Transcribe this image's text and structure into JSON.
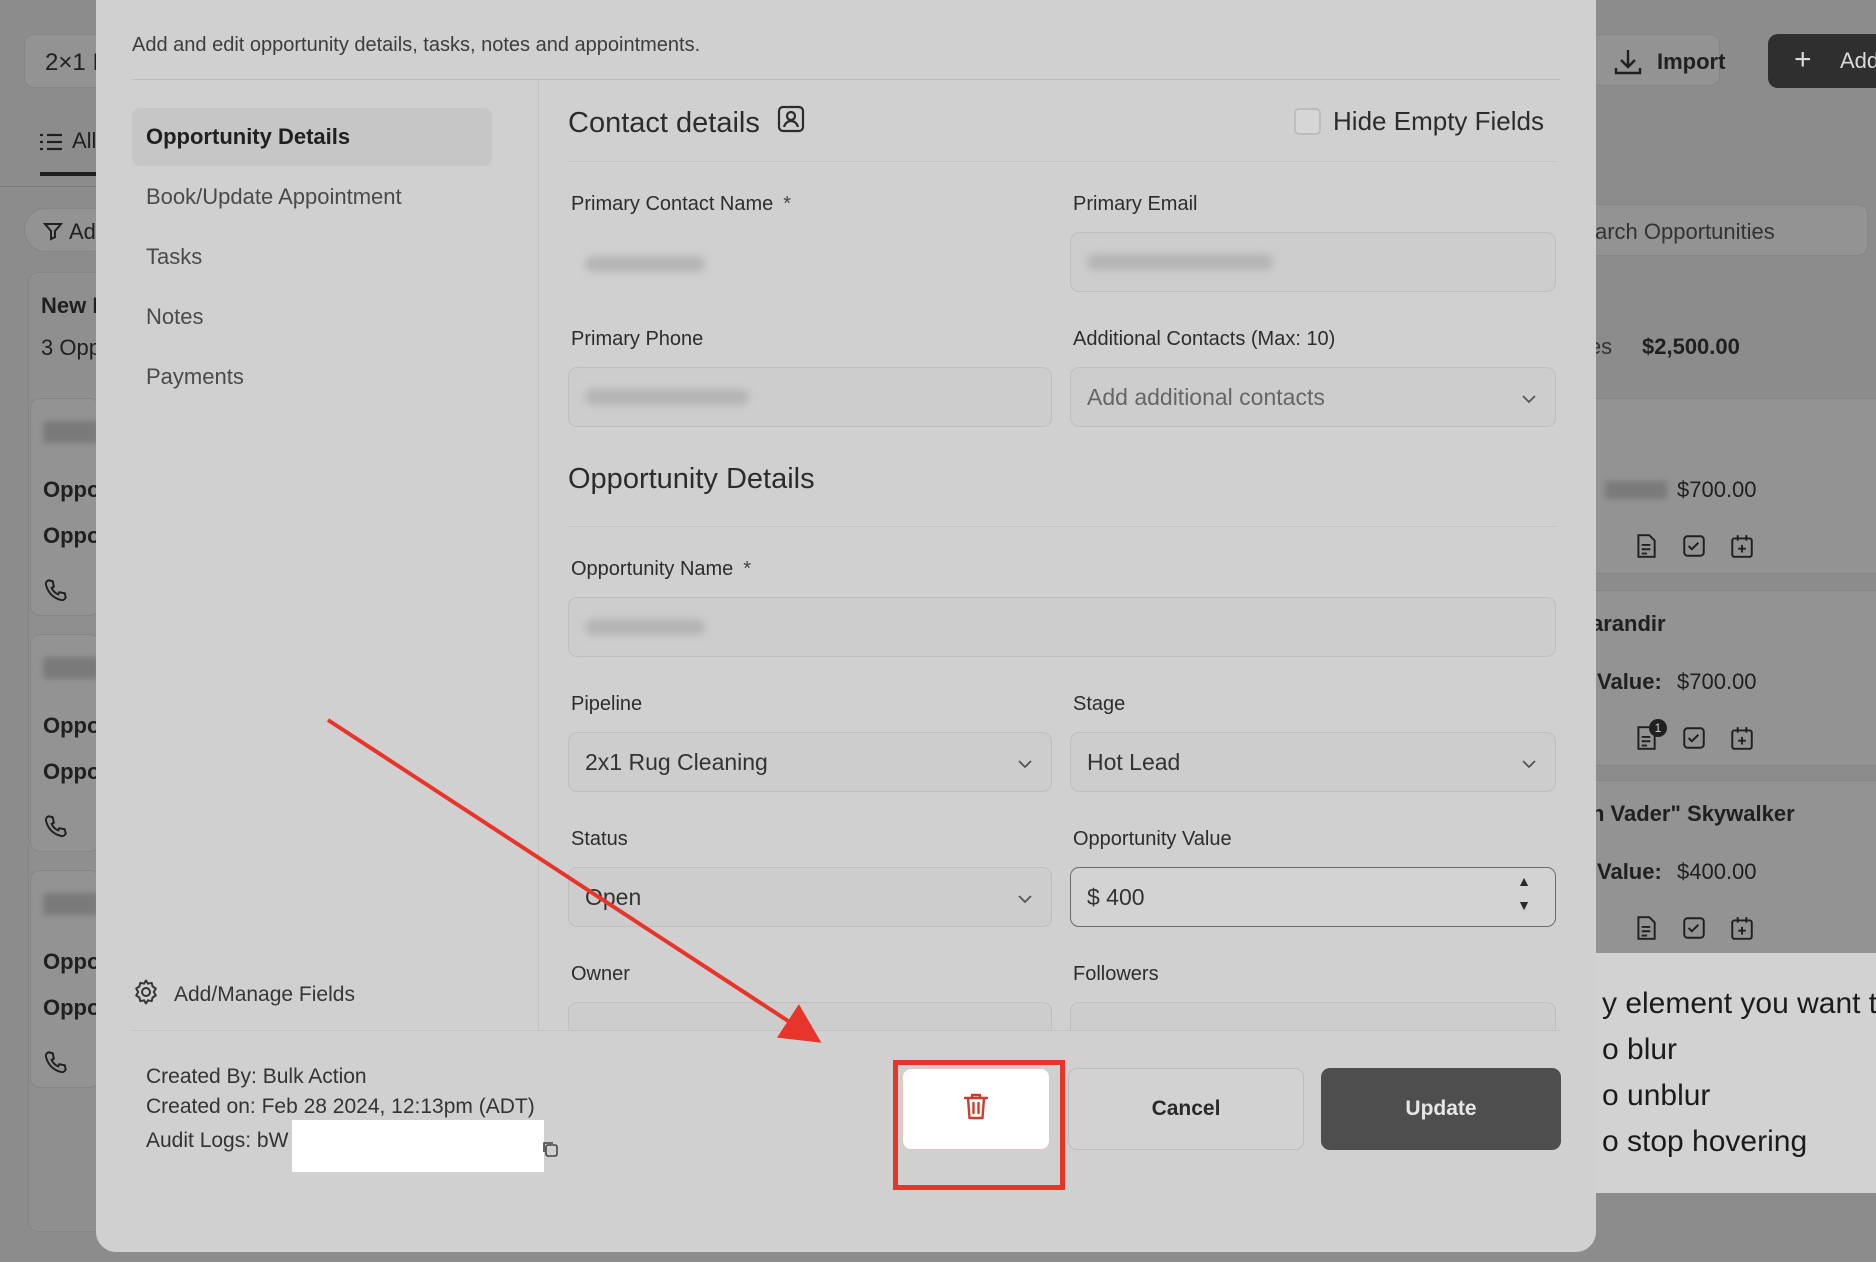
{
  "background": {
    "filter_chip": "2×1 I",
    "tab_all": "All",
    "add_filter": "Ad",
    "import_label": "Import",
    "add_label": "Add",
    "search_placeholder": "arch Opportunities",
    "column_title": "New I",
    "column_count": "3 Opp",
    "column_total_prefix": "ies",
    "column_total_value": "$2,500.00",
    "card_label_1": "Oppo",
    "card_label_2": "Oppo",
    "cards": [
      {
        "name": "",
        "value_label": "",
        "value": "$700.00"
      },
      {
        "name": "arandir",
        "value_label": "Value:",
        "value": "$700.00"
      },
      {
        "name": "h Vader\" Skywalker",
        "value_label": "Value:",
        "value": "$400.00"
      }
    ],
    "note_badge": "1",
    "hint_lines": [
      "y element you want to",
      "o blur",
      "o unblur",
      "o stop hovering"
    ]
  },
  "modal": {
    "subtitle": "Add and edit opportunity details, tasks, notes and appointments.",
    "nav": [
      {
        "label": "Opportunity Details",
        "active": true
      },
      {
        "label": "Book/Update Appointment",
        "active": false
      },
      {
        "label": "Tasks",
        "active": false
      },
      {
        "label": "Notes",
        "active": false
      },
      {
        "label": "Payments",
        "active": false
      }
    ],
    "manage_fields": "Add/Manage Fields",
    "contact": {
      "title": "Contact details",
      "hide_empty": "Hide Empty Fields",
      "primary_name_label": "Primary Contact Name",
      "required_mark": "*",
      "primary_email_label": "Primary Email",
      "primary_phone_label": "Primary Phone",
      "additional_label": "Additional Contacts (Max: 10)",
      "additional_placeholder": "Add additional contacts"
    },
    "opportunity": {
      "title": "Opportunity Details",
      "name_label": "Opportunity Name",
      "pipeline_label": "Pipeline",
      "pipeline_value": "2x1 Rug Cleaning",
      "stage_label": "Stage",
      "stage_value": "Hot Lead",
      "status_label": "Status",
      "status_value": "Open",
      "value_label": "Opportunity Value",
      "value_value": "$ 400",
      "owner_label": "Owner",
      "followers_label": "Followers"
    },
    "footer": {
      "created_by": "Created By: Bulk Action",
      "created_on": "Created on: Feb 28 2024, 12:13pm (ADT)",
      "audit_logs": "Audit Logs: bW",
      "cancel": "Cancel",
      "update": "Update"
    }
  },
  "colors": {
    "annotation_red": "#e8352b",
    "delete_icon": "#d23a2f",
    "update_button": "#4e4e4e"
  }
}
